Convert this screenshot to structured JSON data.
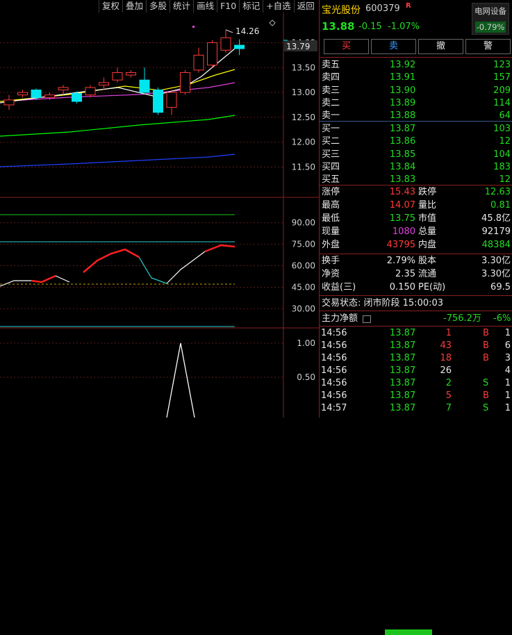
{
  "toolbar": [
    "复权",
    "叠加",
    "多股",
    "统计",
    "画线",
    "F10",
    "标记",
    "+自选",
    "返回"
  ],
  "stock": {
    "name": "宝光股份",
    "code": "600379",
    "r_tag": "R",
    "price": "13.88",
    "change": "-0.15",
    "change_pct": "-1.07%",
    "sector_name": "电网设备",
    "sector_change": "-0.79%"
  },
  "trade_buttons": [
    {
      "label": "买",
      "color": "#ff3b3b"
    },
    {
      "label": "卖",
      "color": "#3a9bff"
    },
    {
      "label": "撤",
      "color": "#e8e8e8"
    },
    {
      "label": "警",
      "color": "#e8e8e8"
    }
  ],
  "asks": [
    {
      "label": "卖五",
      "price": "13.92",
      "vol": "123"
    },
    {
      "label": "卖四",
      "price": "13.91",
      "vol": "157"
    },
    {
      "label": "卖三",
      "price": "13.90",
      "vol": "209"
    },
    {
      "label": "卖二",
      "price": "13.89",
      "vol": "114"
    },
    {
      "label": "卖一",
      "price": "13.88",
      "vol": "64"
    }
  ],
  "bids": [
    {
      "label": "买一",
      "price": "13.87",
      "vol": "103"
    },
    {
      "label": "买二",
      "price": "13.86",
      "vol": "12"
    },
    {
      "label": "买三",
      "price": "13.85",
      "vol": "104"
    },
    {
      "label": "买四",
      "price": "13.84",
      "vol": "183"
    },
    {
      "label": "买五",
      "price": "13.83",
      "vol": "12"
    }
  ],
  "stats": [
    {
      "l1": "涨停",
      "v1": "15.43",
      "c1": "red",
      "l2": "跌停",
      "v2": "12.63",
      "c2": "green"
    },
    {
      "l1": "最高",
      "v1": "14.07",
      "c1": "red",
      "l2": "量比",
      "v2": "0.81",
      "c2": "green"
    },
    {
      "l1": "最低",
      "v1": "13.75",
      "c1": "green",
      "l2": "市值",
      "v2": "45.8亿",
      "c2": "white"
    },
    {
      "l1": "现量",
      "v1": "1080",
      "c1": "mag",
      "l2": "总量",
      "v2": "92179",
      "c2": "white"
    },
    {
      "l1": "外盘",
      "v1": "43795",
      "c1": "red",
      "l2": "内盘",
      "v2": "48384",
      "c2": "green"
    }
  ],
  "stats2": [
    {
      "l1": "换手",
      "v1": "2.79%",
      "l2": "股本",
      "v2": "3.30亿"
    },
    {
      "l1": "净资",
      "v1": "2.35",
      "l2": "流通",
      "v2": "3.30亿"
    },
    {
      "l1": "收益(三)",
      "v1": "0.150",
      "l2": "PE(动)",
      "v2": "69.5"
    }
  ],
  "trade_status": "交易状态: 闭市阶段 15:00:03",
  "net_flow": {
    "label": "主力净额",
    "value": "-756.2万",
    "pct": "-6%"
  },
  "ticks": [
    {
      "time": "14:56",
      "price": "13.87",
      "vol": "1",
      "side": "B",
      "count": "1"
    },
    {
      "time": "14:56",
      "price": "13.87",
      "vol": "43",
      "side": "B",
      "count": "6"
    },
    {
      "time": "14:56",
      "price": "13.87",
      "vol": "18",
      "side": "B",
      "count": "3"
    },
    {
      "time": "14:56",
      "price": "13.87",
      "vol": "26",
      "side": "",
      "count": "4"
    },
    {
      "time": "14:56",
      "price": "13.87",
      "vol": "2",
      "side": "S",
      "count": "1"
    },
    {
      "time": "14:56",
      "price": "13.87",
      "vol": "5",
      "side": "B",
      "count": "1"
    },
    {
      "time": "14:57",
      "price": "13.87",
      "vol": "7",
      "side": "S",
      "count": "1"
    }
  ],
  "chart": {
    "price_axis": [
      "14.00",
      "13.50",
      "13.00",
      "12.50",
      "12.00",
      "11.50"
    ],
    "last_price_tag": "13.79",
    "high_label": "14.26",
    "ind_axis": [
      "90.00",
      "75.00",
      "60.00",
      "45.00",
      "30.00"
    ],
    "bot_axis": [
      "1.00",
      "0.50"
    ]
  },
  "chart_data": [
    {
      "type": "line",
      "name": "candlestick-price",
      "ylim": [
        11.0,
        14.4
      ],
      "candles": [
        {
          "o": 12.75,
          "c": 12.85,
          "h": 12.95,
          "l": 12.65
        },
        {
          "o": 12.95,
          "c": 13.0,
          "h": 13.05,
          "l": 12.9
        },
        {
          "o": 13.05,
          "c": 12.9,
          "h": 13.08,
          "l": 12.85
        },
        {
          "o": 12.9,
          "c": 12.95,
          "h": 13.0,
          "l": 12.85
        },
        {
          "o": 13.05,
          "c": 13.1,
          "h": 13.15,
          "l": 12.95
        },
        {
          "o": 12.98,
          "c": 12.82,
          "h": 13.02,
          "l": 12.78
        },
        {
          "o": 12.95,
          "c": 13.1,
          "h": 13.15,
          "l": 12.9
        },
        {
          "o": 13.15,
          "c": 13.2,
          "h": 13.3,
          "l": 13.05
        },
        {
          "o": 13.25,
          "c": 13.4,
          "h": 13.5,
          "l": 13.2
        },
        {
          "o": 13.35,
          "c": 13.4,
          "h": 13.45,
          "l": 13.3
        },
        {
          "o": 13.25,
          "c": 13.0,
          "h": 13.5,
          "l": 13.0
        },
        {
          "o": 13.05,
          "c": 12.6,
          "h": 13.1,
          "l": 12.55
        },
        {
          "o": 12.7,
          "c": 13.0,
          "h": 13.05,
          "l": 12.55
        },
        {
          "o": 13.0,
          "c": 13.4,
          "h": 13.45,
          "l": 12.95
        },
        {
          "o": 13.45,
          "c": 13.75,
          "h": 13.9,
          "l": 13.4
        },
        {
          "o": 13.55,
          "c": 14.0,
          "h": 14.05,
          "l": 13.5
        },
        {
          "o": 13.85,
          "c": 14.1,
          "h": 14.26,
          "l": 13.8
        },
        {
          "o": 13.95,
          "c": 13.88,
          "h": 14.07,
          "l": 13.75
        }
      ]
    }
  ],
  "colors": {
    "up": "#ff3b3b",
    "down": "#00e5ee",
    "ma1": "#ffffff",
    "ma2": "#ffff00",
    "ma3": "#e040e0",
    "ma4": "#00ff00",
    "ma5": "#2040ff"
  }
}
